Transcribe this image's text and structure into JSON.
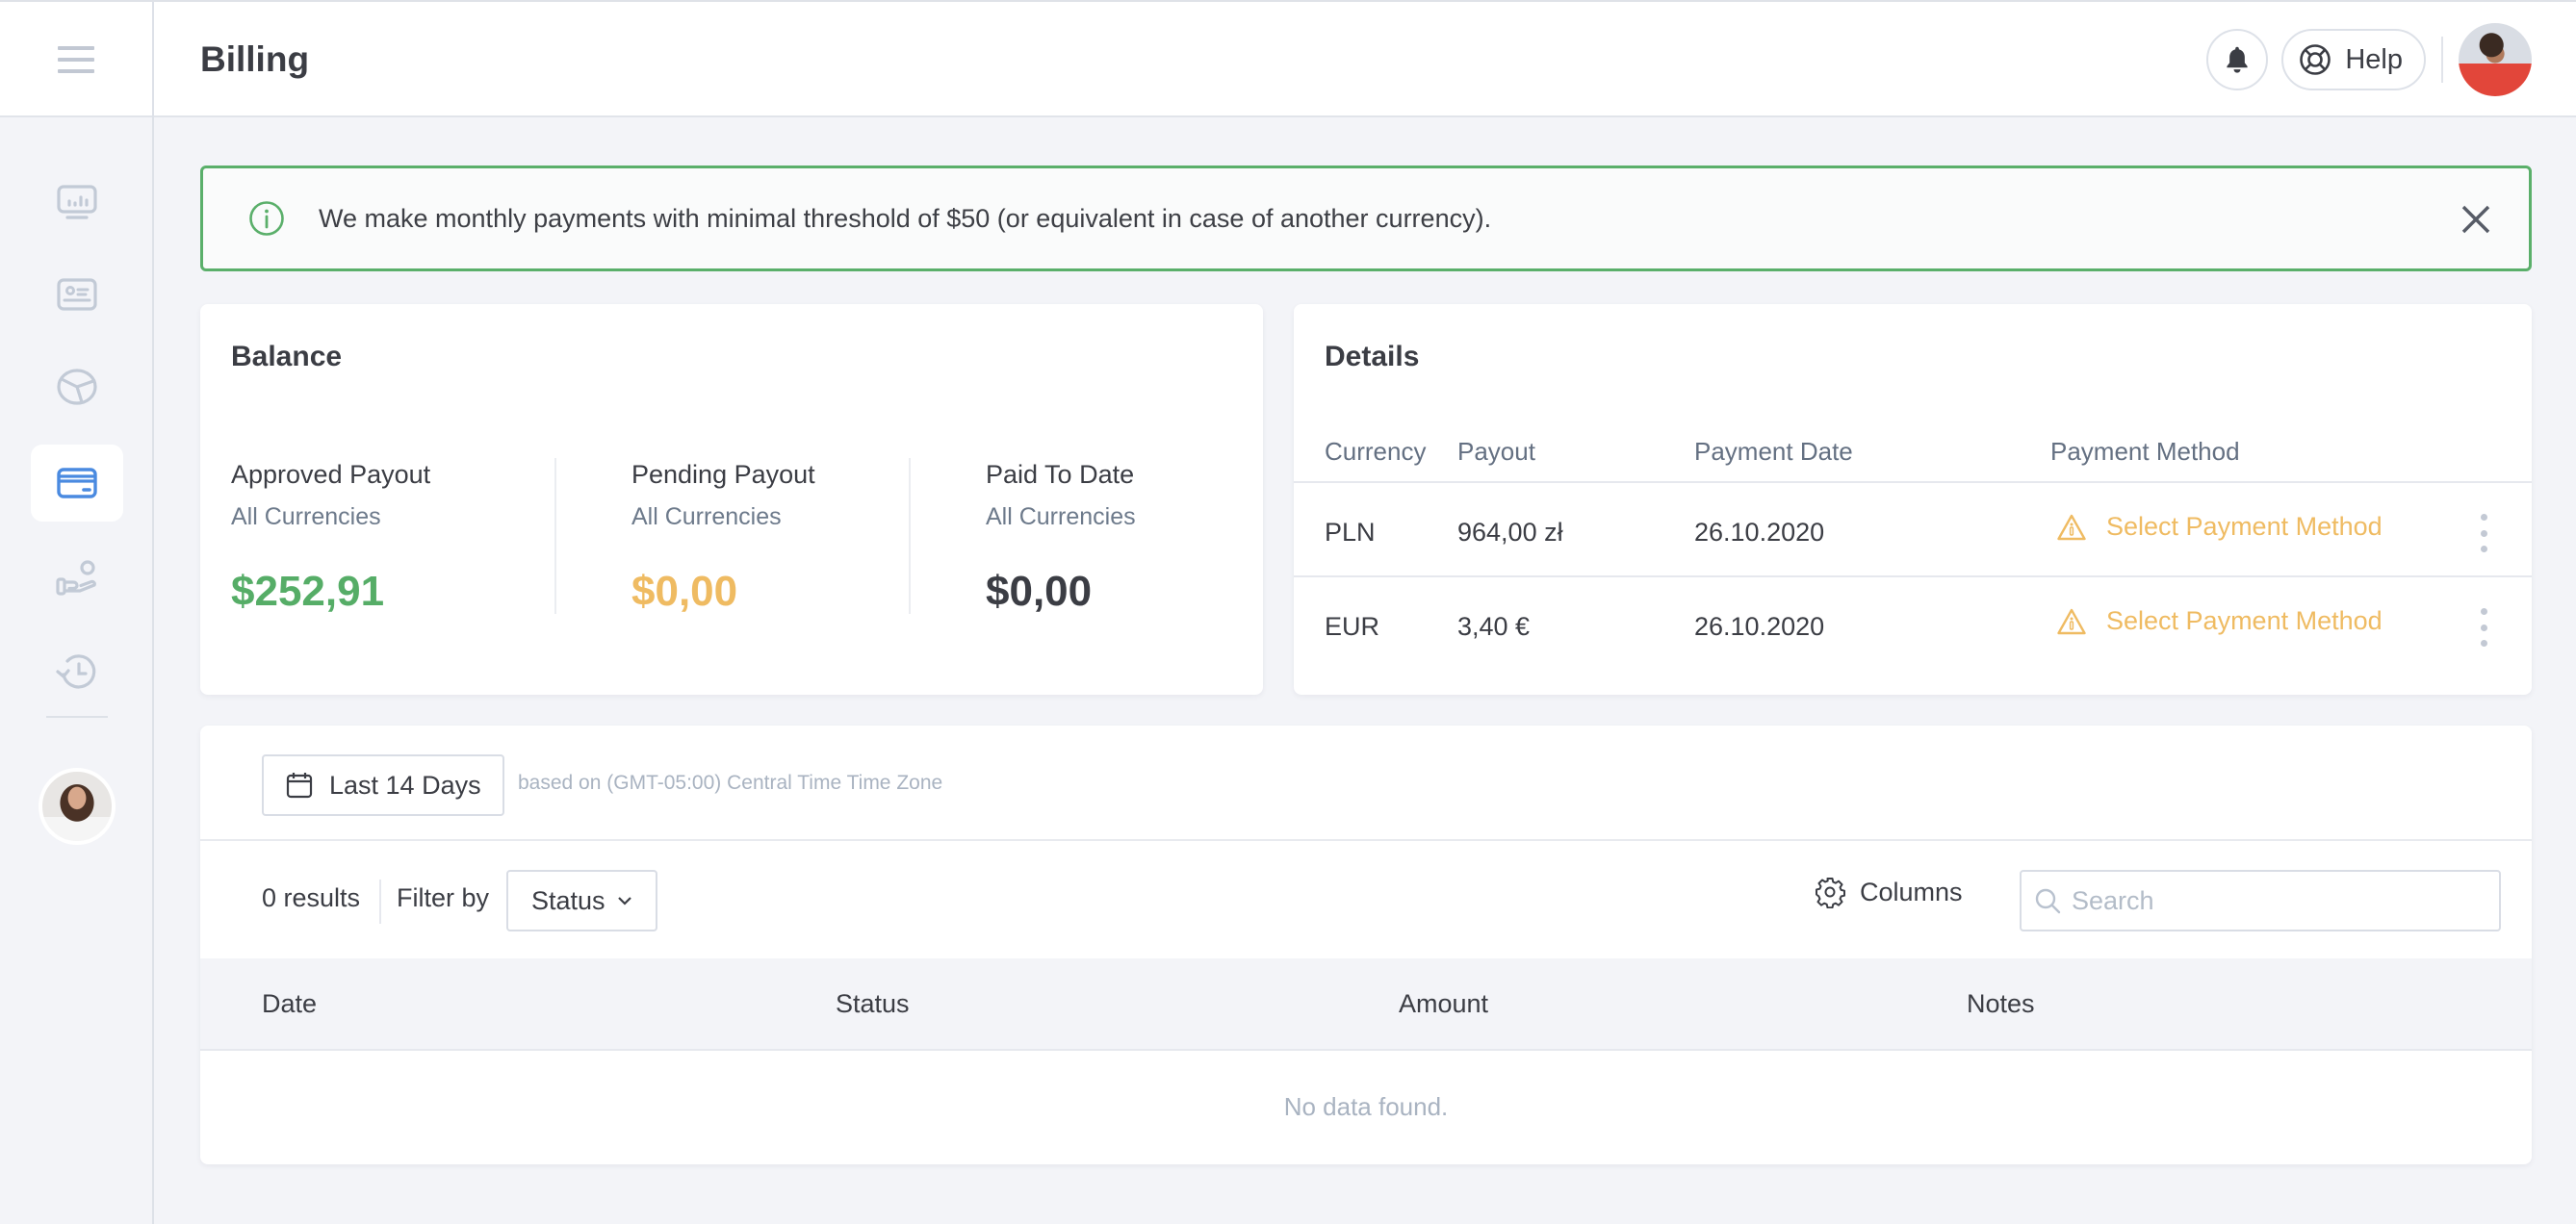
{
  "header": {
    "title": "Billing",
    "help_label": "Help",
    "icons": {
      "menu": "hamburger-icon",
      "bell": "bell-icon",
      "help": "lifebuoy-icon"
    }
  },
  "sidebar": {
    "items": [
      {
        "id": "dashboard",
        "icon": "monitor-chart-icon",
        "active": false
      },
      {
        "id": "profile",
        "icon": "id-card-icon",
        "active": false
      },
      {
        "id": "reports",
        "icon": "pie-chart-icon",
        "active": false
      },
      {
        "id": "billing",
        "icon": "credit-card-icon",
        "active": true
      },
      {
        "id": "payouts",
        "icon": "hand-coin-icon",
        "active": false
      },
      {
        "id": "history",
        "icon": "history-icon",
        "active": false
      }
    ]
  },
  "alert": {
    "text": "We make monthly payments with minimal threshold of $50 (or equivalent in case of another currency).",
    "icon": "info-circle-icon",
    "color": "#5aaf6a"
  },
  "balance": {
    "title": "Balance",
    "stats": [
      {
        "label": "Approved Payout",
        "sub": "All Currencies",
        "value": "$252,91",
        "color": "#56ad67"
      },
      {
        "label": "Pending Payout",
        "sub": "All Currencies",
        "value": "$0,00",
        "color": "#efbb62"
      },
      {
        "label": "Paid To Date",
        "sub": "All Currencies",
        "value": "$0,00",
        "color": "#3b3d44"
      }
    ]
  },
  "details": {
    "title": "Details",
    "columns": [
      "Currency",
      "Payout",
      "Payment Date",
      "Payment Method"
    ],
    "rows": [
      {
        "currency": "PLN",
        "payout": "964,00 zł",
        "date": "26.10.2020",
        "method": "Select Payment Method"
      },
      {
        "currency": "EUR",
        "payout": "3,40 €",
        "date": "26.10.2020",
        "method": "Select Payment Method"
      }
    ],
    "warning_color": "#efbb62"
  },
  "transactions": {
    "date_range": "Last 14 Days",
    "timezone_note": "based on (GMT-05:00) Central Time Time Zone",
    "results": "0 results",
    "filter_label": "Filter by",
    "filter_value": "Status",
    "columns_label": "Columns",
    "search_placeholder": "Search",
    "search_value": "",
    "table_columns": [
      "Date",
      "Status",
      "Amount",
      "Notes"
    ],
    "empty_text": "No data found."
  },
  "colors": {
    "accent": "#4a8ae0",
    "success": "#56ad67",
    "warning": "#efbb62",
    "background": "#f3f4f8"
  }
}
